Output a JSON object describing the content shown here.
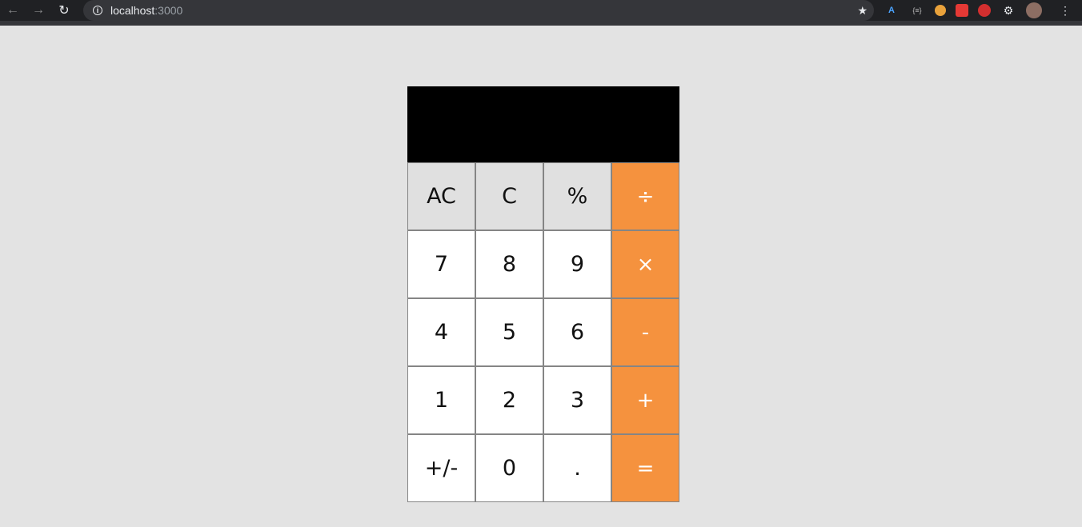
{
  "browser": {
    "url_host": "localhost",
    "url_port": ":3000"
  },
  "calculator": {
    "display": "",
    "keys": [
      {
        "label": "AC",
        "type": "fn",
        "name": "all-clear-button"
      },
      {
        "label": "C",
        "type": "fn",
        "name": "clear-button"
      },
      {
        "label": "%",
        "type": "fn",
        "name": "percent-button"
      },
      {
        "label": "÷",
        "type": "op",
        "name": "divide-button"
      },
      {
        "label": "7",
        "type": "num",
        "name": "digit-7-button"
      },
      {
        "label": "8",
        "type": "num",
        "name": "digit-8-button"
      },
      {
        "label": "9",
        "type": "num",
        "name": "digit-9-button"
      },
      {
        "label": "×",
        "type": "op",
        "name": "multiply-button"
      },
      {
        "label": "4",
        "type": "num",
        "name": "digit-4-button"
      },
      {
        "label": "5",
        "type": "num",
        "name": "digit-5-button"
      },
      {
        "label": "6",
        "type": "num",
        "name": "digit-6-button"
      },
      {
        "label": "-",
        "type": "op",
        "name": "subtract-button"
      },
      {
        "label": "1",
        "type": "num",
        "name": "digit-1-button"
      },
      {
        "label": "2",
        "type": "num",
        "name": "digit-2-button"
      },
      {
        "label": "3",
        "type": "num",
        "name": "digit-3-button"
      },
      {
        "label": "+",
        "type": "op",
        "name": "add-button"
      },
      {
        "label": "+/-",
        "type": "num",
        "name": "toggle-sign-button"
      },
      {
        "label": "0",
        "type": "num",
        "name": "digit-0-button"
      },
      {
        "label": ".",
        "type": "num",
        "name": "decimal-button"
      },
      {
        "label": "=",
        "type": "op",
        "name": "equals-button"
      }
    ]
  },
  "colors": {
    "page_background": "#e3e3e3",
    "display_background": "#000000",
    "function_key": "#e0e0e0",
    "operator_key": "#f5923e",
    "number_key": "#ffffff"
  }
}
